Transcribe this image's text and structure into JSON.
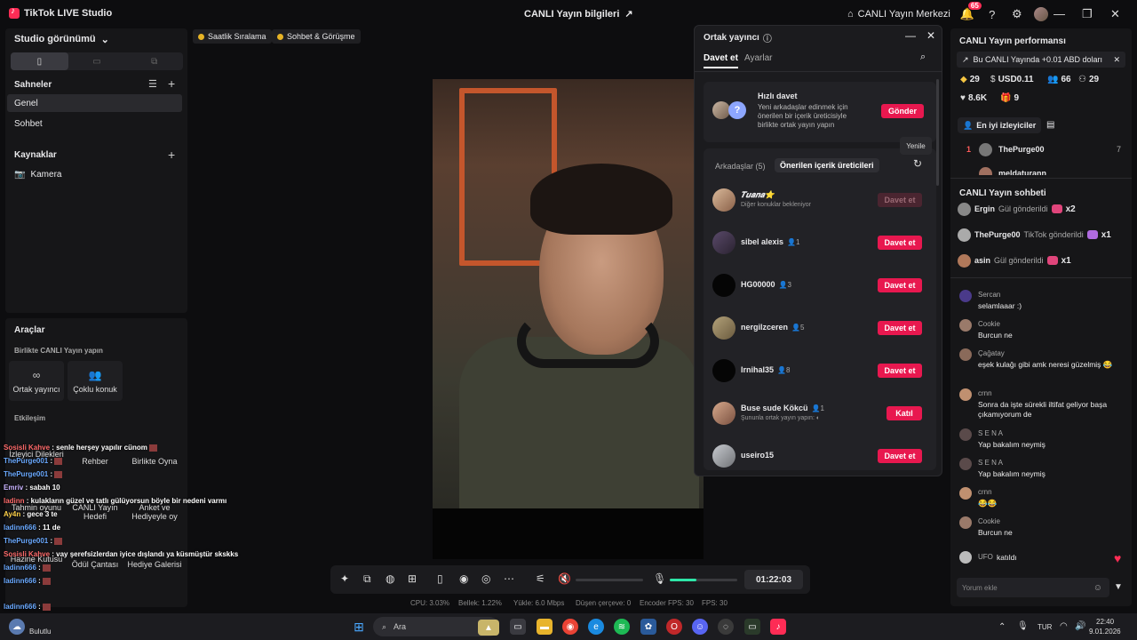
{
  "app": {
    "title": "TikTok LIVE Studio",
    "center_title": "CANLI Yayın bilgileri",
    "live_center": "CANLI Yayın Merkezi",
    "notif_count": "65"
  },
  "left": {
    "studio_view": "Studio görünümü",
    "scenes_header": "Sahneler",
    "scenes": [
      "Genel",
      "Sohbet"
    ],
    "sources_header": "Kaynaklar",
    "sources": [
      "Kamera"
    ]
  },
  "tools": {
    "header": "Araçlar",
    "collab_header": "Birlikte CANLI Yayın yapın",
    "cohost": "Ortak yayıncı",
    "multi_guest": "Çoklu konuk",
    "interaction_header": "Etkileşim",
    "items": [
      "Rehber",
      "Birlikte Oyna",
      "CANLI Yayın Hedefi",
      "Anket ve Hediyeyle oy",
      "Ödül Çantası",
      "Hediye Galerisi"
    ],
    "partial": [
      "İzleyici Dilekleri",
      "Tahmin oyunu",
      "Hazine Kutusu",
      "Bulutlu"
    ]
  },
  "overlay_chat": [
    {
      "user": "Sosisli Kahve",
      "text": ": senle herşey yapılır cünom"
    },
    {
      "user": "ThePurge001",
      "text": ":"
    },
    {
      "user": "ThePurge001",
      "text": ":"
    },
    {
      "user": "Emriv",
      "text": ": sabah 10"
    },
    {
      "user": "ladinn",
      "text": ": kulakların güzel ve tatlı gülüyorsun böyle bir nedeni varmı"
    },
    {
      "user": "Ay4n",
      "text": ": gece 3 te"
    },
    {
      "user": "ladinn666",
      "text": ": 11 de"
    },
    {
      "user": "ThePurge001",
      "text": ":"
    },
    {
      "user": "Sosisli Kahve",
      "text": ": vay şerefsizlerdan iyice dışlandı ya küsmüştür skskks"
    },
    {
      "user": "ladinn666",
      "text": ":"
    },
    {
      "user": "ladinn666",
      "text": ":"
    },
    {
      "user": "ladinn666",
      "text": ":"
    },
    {
      "user": "ladinn666",
      "text": ":"
    }
  ],
  "chips": [
    "Saatlik Sıralama",
    "Sohbet & Görüşme"
  ],
  "controls": {
    "timer": "01:22:03"
  },
  "stats": {
    "cpu": "CPU: 3.03%",
    "mem": "Bellek: 1.22%",
    "upload": "Yükle: 6.0 Mbps",
    "dropped": "Düşen çerçeve: 0",
    "encoder_fps": "Encoder FPS: 30",
    "fps": "FPS: 30"
  },
  "cohost": {
    "title": "Ortak yayıncı",
    "tabs": [
      "Davet et",
      "Ayarlar"
    ],
    "quick_title": "Hızlı davet",
    "quick_desc": "Yeni arkadaşlar edinmek için önerilen bir içerik üreticisiyle birlikte ortak yayın yapın",
    "send": "Gönder",
    "friends_tab": "Arkadaşlar (5)",
    "suggested_tab": "Önerilen içerik üreticileri",
    "refresh_tooltip": "Yenile",
    "rows": [
      {
        "name": "𝑻𝒖𝒂𝒏𝒂⭐",
        "sub": "Diğer konuklar bekleniyor",
        "count": "",
        "btn": "Davet et"
      },
      {
        "name": "sibel alexis",
        "sub": "",
        "count": "1",
        "btn": "Davet et"
      },
      {
        "name": "HG00000",
        "sub": "",
        "count": "3",
        "btn": "Davet et"
      },
      {
        "name": "nergilzceren",
        "sub": "",
        "count": "5",
        "btn": "Davet et"
      },
      {
        "name": "Irnihal35",
        "sub": "",
        "count": "8",
        "btn": "Davet et"
      },
      {
        "name": "Buse sude Kökcü",
        "sub": "Şununla ortak yayın yapın:",
        "count": "1",
        "btn": "Katıl"
      },
      {
        "name": "useiro15",
        "sub": "",
        "count": "",
        "btn": "Davet et"
      }
    ]
  },
  "right": {
    "perf_title": "CANLI Yayın performansı",
    "banner": "Bu CANLI Yayında +0.01 ABD doları",
    "metrics": [
      "29",
      "USD0.11",
      "66",
      "29",
      "8.6K",
      "9"
    ],
    "top_viewers": "En iyi izleyiciler",
    "ranks": [
      {
        "num": "1",
        "name": "ThePurge00",
        "score": "7"
      },
      {
        "num": "",
        "name": "meldaturann",
        "score": ""
      }
    ],
    "chat_title": "CANLI Yayın sohbeti",
    "gifts": [
      {
        "name": "Ergin",
        "text": "Gül gönderildi",
        "mult": "x2"
      },
      {
        "name": "ThePurge00",
        "text": "TikTok gönderildi",
        "mult": "x1"
      },
      {
        "name": "asin",
        "text": "Gül gönderildi",
        "mult": "x1"
      }
    ],
    "messages": [
      {
        "user": "Sercan",
        "text": "selamlaaar :)"
      },
      {
        "user": "Cookie",
        "text": "Burcun ne"
      },
      {
        "user": "Çağatay",
        "text": "eşek kulağı gibi amk neresi güzelmiş 😂"
      },
      {
        "user": "crnn",
        "text": "Sonra da işte sürekli iltifat geliyor başa çıkamıyorum de"
      },
      {
        "user": "S E N A",
        "text": "Yap bakalım neymiş"
      },
      {
        "user": "S E N A",
        "text": "Yap bakalım neymiş"
      },
      {
        "user": "crnn",
        "text": "😂😂"
      },
      {
        "user": "Cookie",
        "text": "Burcun ne"
      }
    ],
    "join": {
      "user": "UFO",
      "text": "katıldı"
    },
    "comment_placeholder": "Yorum ekle"
  },
  "taskbar": {
    "search": "Ara",
    "lang": "TUR",
    "time": "22:40",
    "date": "9.01.2026",
    "weather": "Bulutlu"
  }
}
